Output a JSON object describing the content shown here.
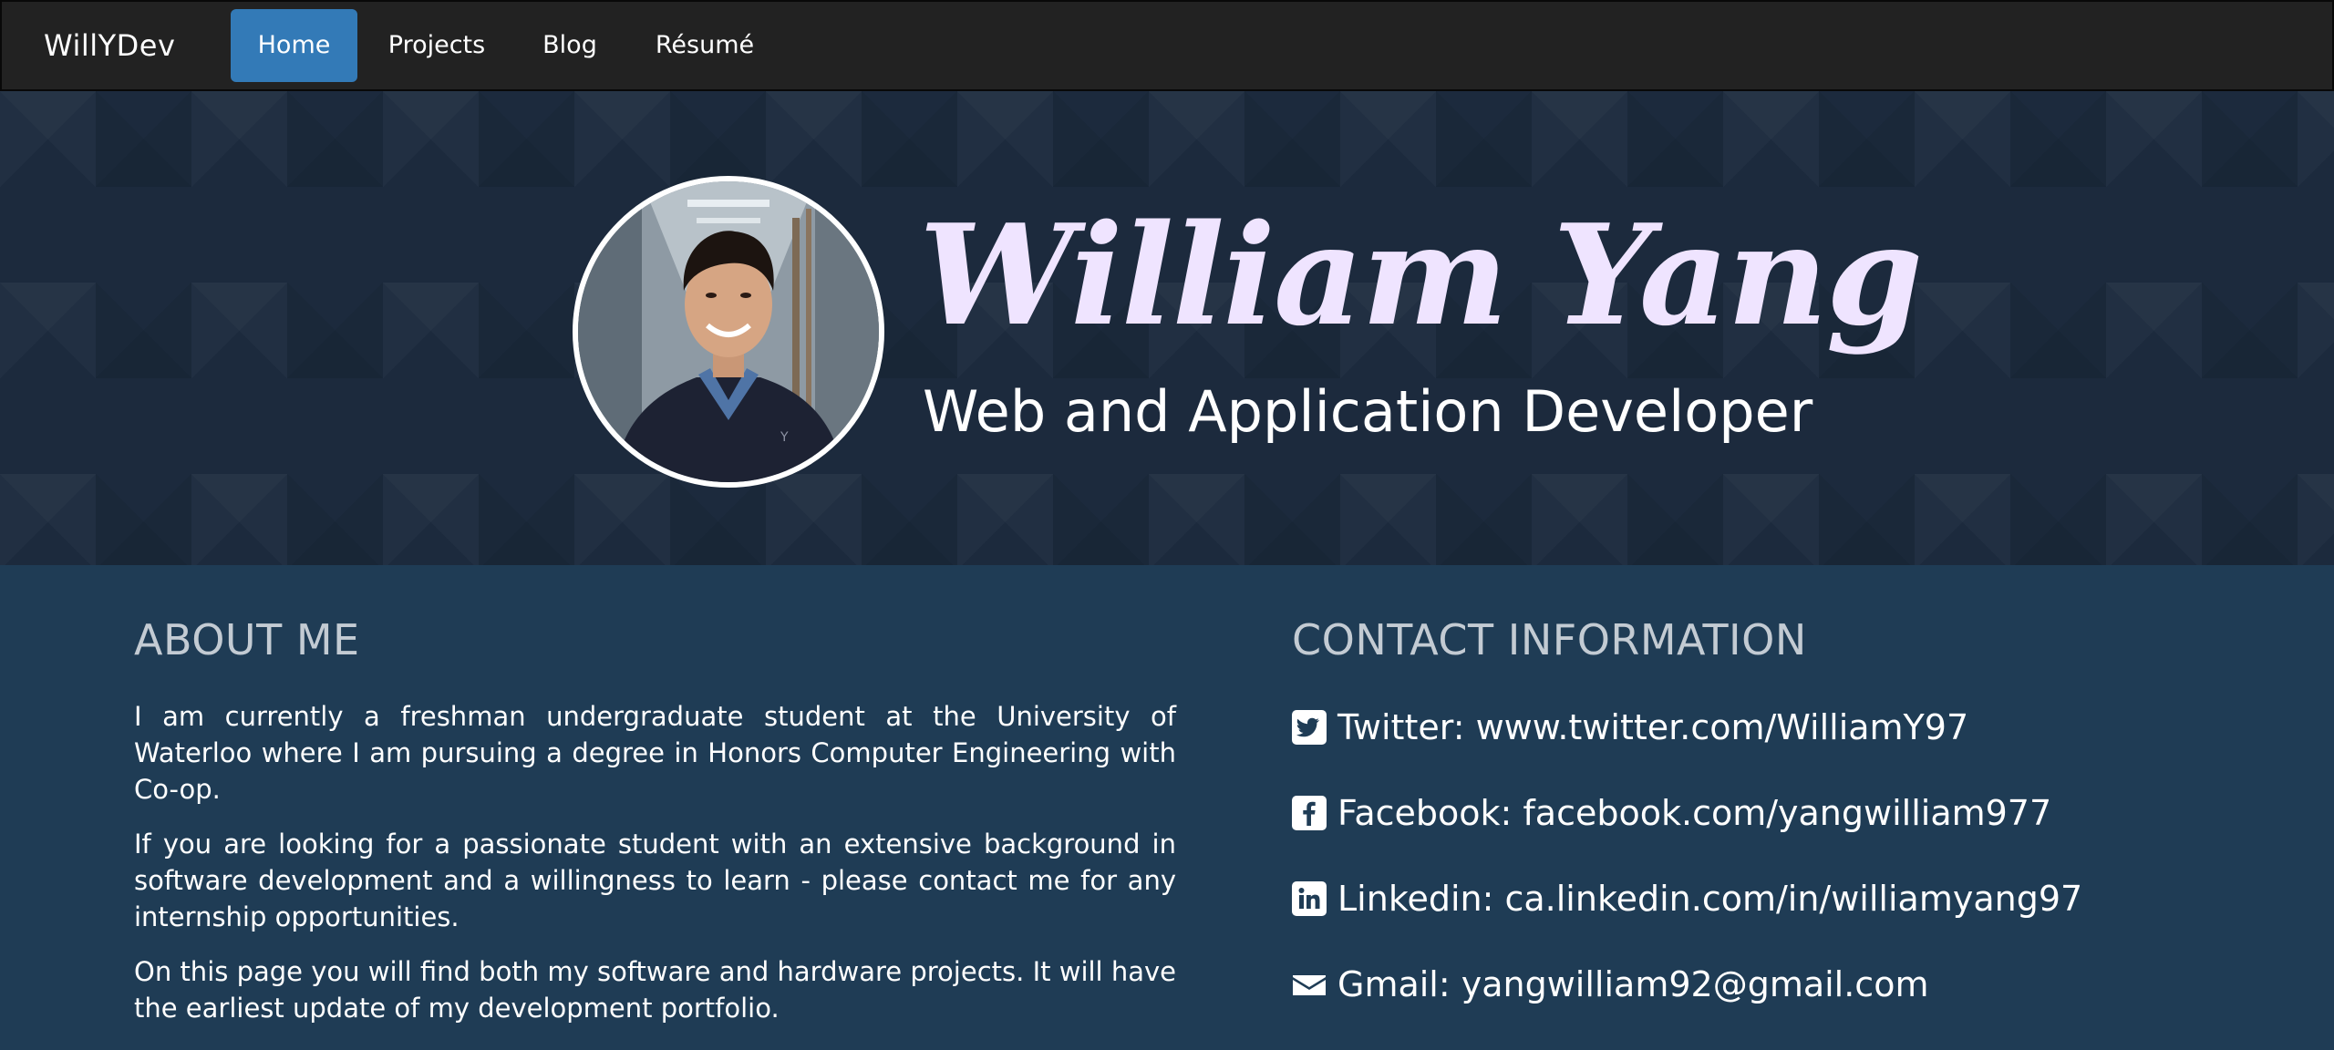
{
  "navbar": {
    "brand": "WillYDev",
    "items": [
      {
        "label": "Home",
        "active": true
      },
      {
        "label": "Projects",
        "active": false
      },
      {
        "label": "Blog",
        "active": false
      },
      {
        "label": "Résumé",
        "active": false
      }
    ]
  },
  "hero": {
    "name": "William Yang",
    "subtitle": "Web and Application Developer",
    "avatar_icon": "profile-photo"
  },
  "about": {
    "title": "ABOUT ME",
    "paragraphs": [
      "I am currently a freshman undergraduate student at the University of Waterloo where I am pursuing a degree in Honors Computer Engineering with Co-op.",
      "If you are looking for a passionate student with an extensive background in software development and a willingness to learn - please contact me for any internship opportunities.",
      "On this page you will find both my software and hardware projects. It will have the earliest update of my development portfolio."
    ]
  },
  "contact": {
    "title": "CONTACT INFORMATION",
    "items": [
      {
        "icon": "twitter-icon",
        "text": "Twitter: www.twitter.com/WilliamY97"
      },
      {
        "icon": "facebook-icon",
        "text": "Facebook: facebook.com/yangwilliam977"
      },
      {
        "icon": "linkedin-icon",
        "text": "Linkedin: ca.linkedin.com/in/williamyang97"
      },
      {
        "icon": "envelope-icon",
        "text": "Gmail: yangwilliam92@gmail.com"
      }
    ]
  },
  "colors": {
    "navbar_bg": "#222222",
    "active_nav": "#337ab7",
    "hero_bg": "#1c2a3d",
    "content_bg": "#1f3c55",
    "name_color": "#efe4ff",
    "section_title": "#c3cbd3"
  }
}
